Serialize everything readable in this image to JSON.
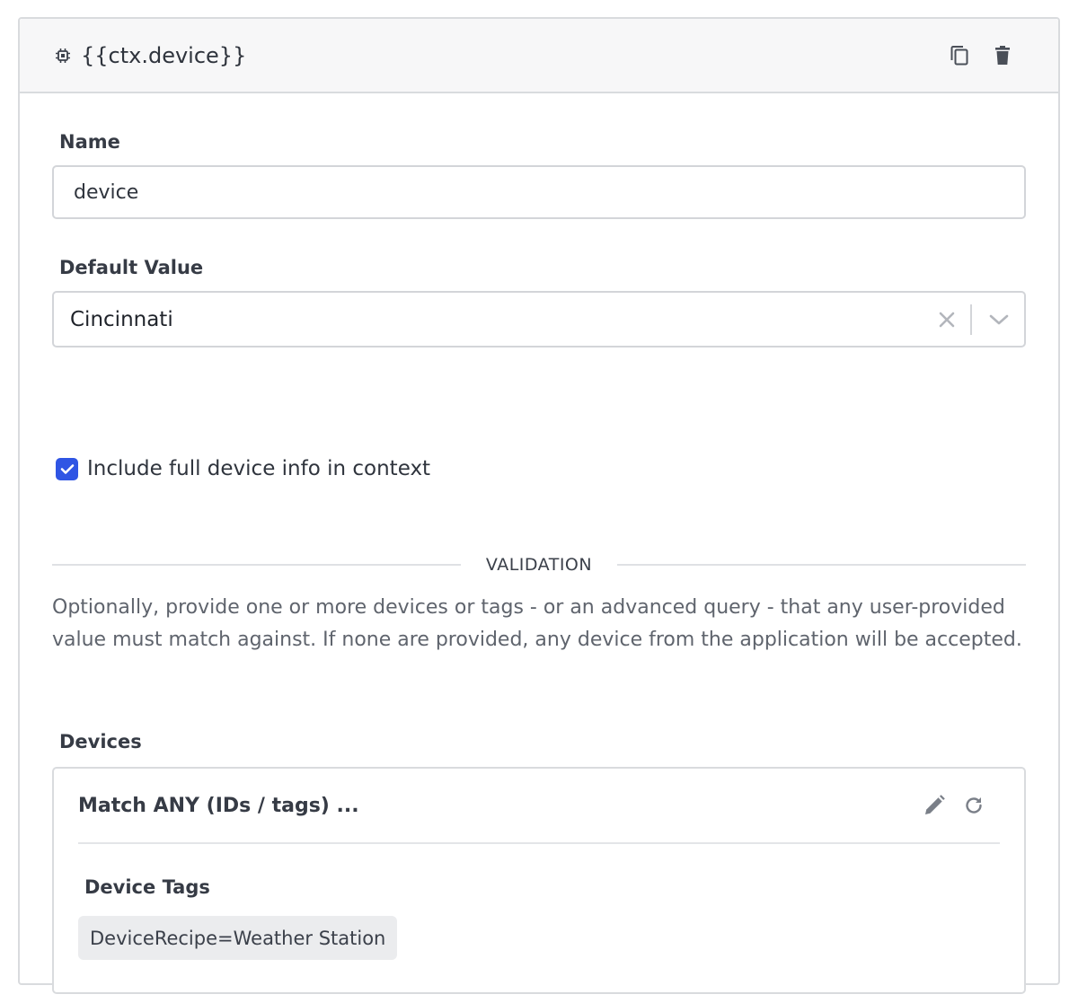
{
  "header": {
    "title": "{{ctx.device}}",
    "icon": "chip-icon",
    "actions": [
      "copy-icon",
      "trash-icon"
    ]
  },
  "name_field": {
    "label": "Name",
    "value": "device"
  },
  "default_value_field": {
    "label": "Default Value",
    "value": "Cincinnati"
  },
  "include_full_info": {
    "label": "Include full device info in context",
    "checked": true
  },
  "validation": {
    "divider_label": "VALIDATION",
    "help_text": "Optionally, provide one or more devices or tags - or an advanced query - that any user-provided value must match against. If none are provided, any device from the application will be accepted."
  },
  "devices": {
    "label": "Devices",
    "panel_title": "Match ANY (IDs / tags) ...",
    "tags_label": "Device Tags",
    "tags": [
      "DeviceRecipe=Weather Station"
    ]
  },
  "colors": {
    "accent": "#2f55e4",
    "border": "#d9dbde",
    "header_bg": "#f7f7f8",
    "tag_bg": "#ebecee"
  }
}
